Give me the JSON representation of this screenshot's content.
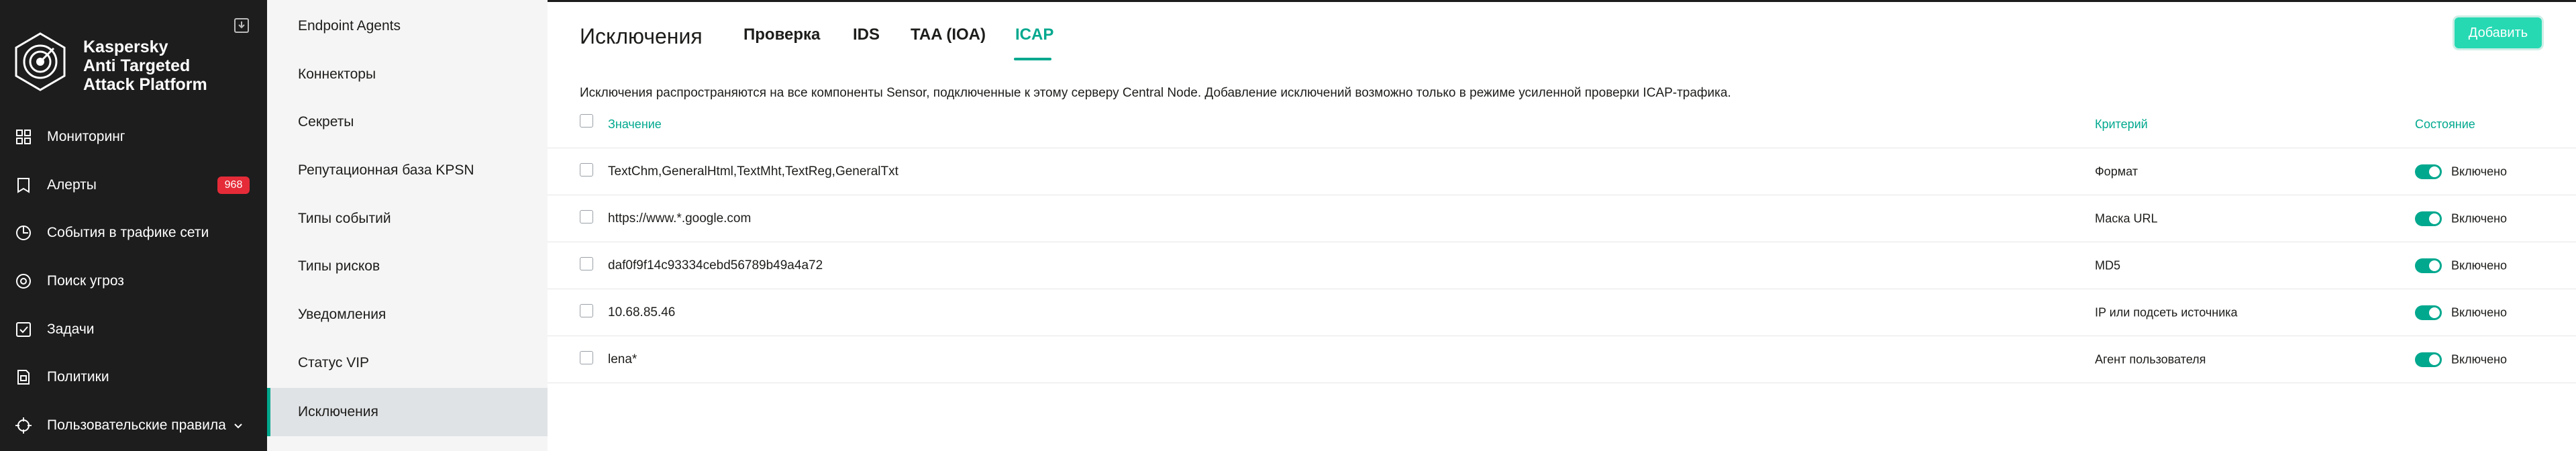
{
  "app": {
    "brand_line1": "Kaspersky",
    "brand_line2": "Anti Targeted",
    "brand_line3": "Attack Platform"
  },
  "nav": {
    "items": [
      {
        "label": "Мониторинг",
        "icon": "dashboard-icon"
      },
      {
        "label": "Алерты",
        "icon": "alerts-icon",
        "badge": "968"
      },
      {
        "label": "События в трафике сети",
        "icon": "network-icon"
      },
      {
        "label": "Поиск угроз",
        "icon": "threat-search-icon"
      },
      {
        "label": "Задачи",
        "icon": "tasks-icon"
      },
      {
        "label": "Политики",
        "icon": "policies-icon"
      },
      {
        "label": "Пользовательские правила",
        "icon": "rules-icon"
      }
    ]
  },
  "submenu": {
    "items": [
      {
        "label": "Endpoint Agents"
      },
      {
        "label": "Коннекторы"
      },
      {
        "label": "Секреты"
      },
      {
        "label": "Репутационная база KPSN"
      },
      {
        "label": "Типы событий"
      },
      {
        "label": "Типы рисков"
      },
      {
        "label": "Уведомления"
      },
      {
        "label": "Статус VIP"
      },
      {
        "label": "Исключения"
      }
    ],
    "active_index": 8
  },
  "main": {
    "title": "Исключения",
    "tabs": [
      "Проверка",
      "IDS",
      "TAA (IOA)",
      "ICAP"
    ],
    "active_tab": "ICAP",
    "add_button": "Добавить",
    "info": "Исключения распространяются на все компоненты Sensor, подключенные к этому серверу Central Node. Добавление исключений возможно только в режиме усиленной проверки ICAP-трафика."
  },
  "table": {
    "headers": {
      "value": "Значение",
      "criterion": "Критерий",
      "state": "Состояние"
    },
    "rows": [
      {
        "value": "TextChm,GeneralHtml,TextMht,TextReg,GeneralTxt",
        "criterion": "Формат",
        "state": "Включено"
      },
      {
        "value": "https://www.*.google.com",
        "criterion": "Маска URL",
        "state": "Включено"
      },
      {
        "value": "daf0f9f14c93334cebd56789b49a4a72",
        "criterion": "MD5",
        "state": "Включено"
      },
      {
        "value": "10.68.85.46",
        "criterion": "IP или подсеть источника",
        "state": "Включено"
      },
      {
        "value": "lena*",
        "criterion": "Агент пользователя",
        "state": "Включено"
      }
    ]
  },
  "colors": {
    "accent": "#00a88e",
    "nav_bg": "#1d1d1d",
    "badge": "#e52b38",
    "button": "#26d9b3"
  }
}
